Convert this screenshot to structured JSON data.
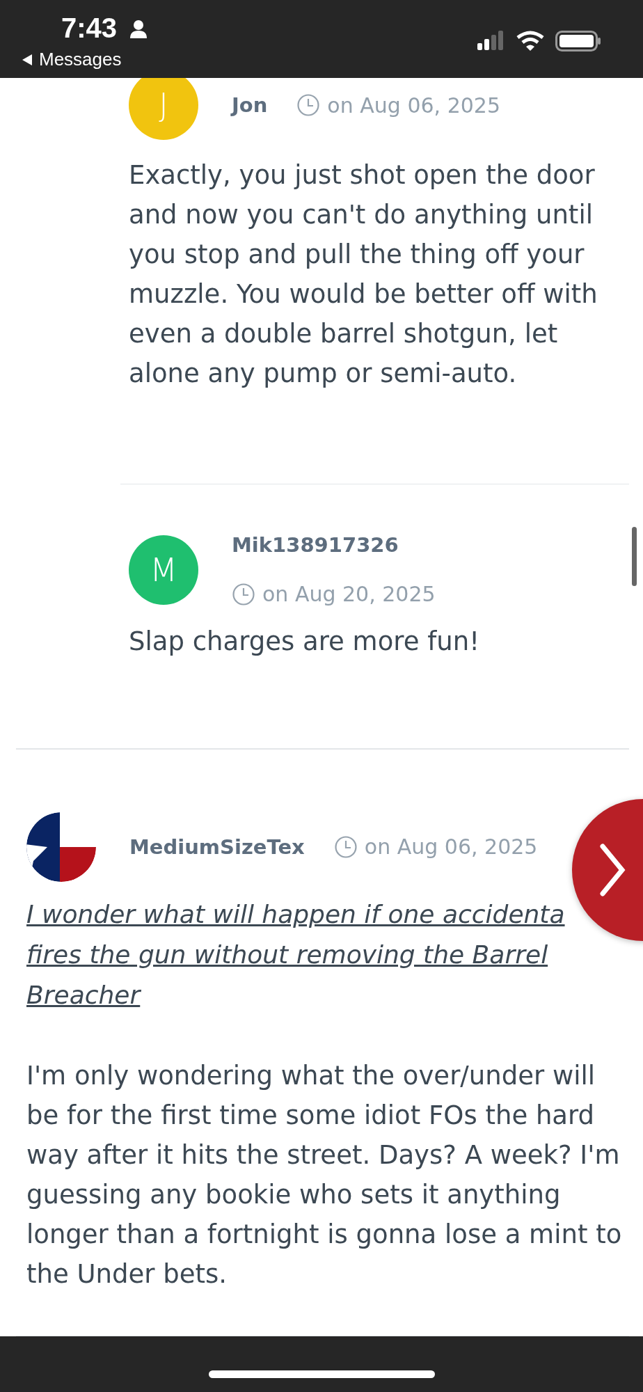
{
  "status_bar": {
    "time": "7:43",
    "back_label": "Messages"
  },
  "comments": [
    {
      "author": "Jon",
      "kind": "letter",
      "initial": "J",
      "color": "#f1c40f",
      "date": "on Aug 06, 2025",
      "reply": true,
      "date_below": false,
      "paragraphs": [
        "Exactly, you just shot open the door and now you can't do anything until you stop and pull the thing off your muzzle. You would be better off with even a double barrel shotgun, let alone any pump or semi-auto."
      ]
    },
    {
      "author": "Mik138917326",
      "kind": "letter",
      "initial": "M",
      "color": "#1fbf6f",
      "date": "on Aug 20, 2025",
      "reply": true,
      "date_below": true,
      "paragraphs": [
        "Slap charges are more fun!"
      ]
    },
    {
      "author": "MediumSizeTex",
      "kind": "picture",
      "date": "on Aug 06, 2025",
      "reply": false,
      "date_below": false,
      "quote_lines": [
        "I wonder what will happen if one accidenta",
        "fires the gun without removing the Barrel",
        "Breacher"
      ],
      "paragraphs": [
        "I'm only wondering what the over/under will be for the first time some idiot FOs the hard way after it hits the street. Days? A week? I'm guessing any bookie who sets it anything longer than a fortnight is gonna lose a mint to the Under bets."
      ]
    }
  ]
}
